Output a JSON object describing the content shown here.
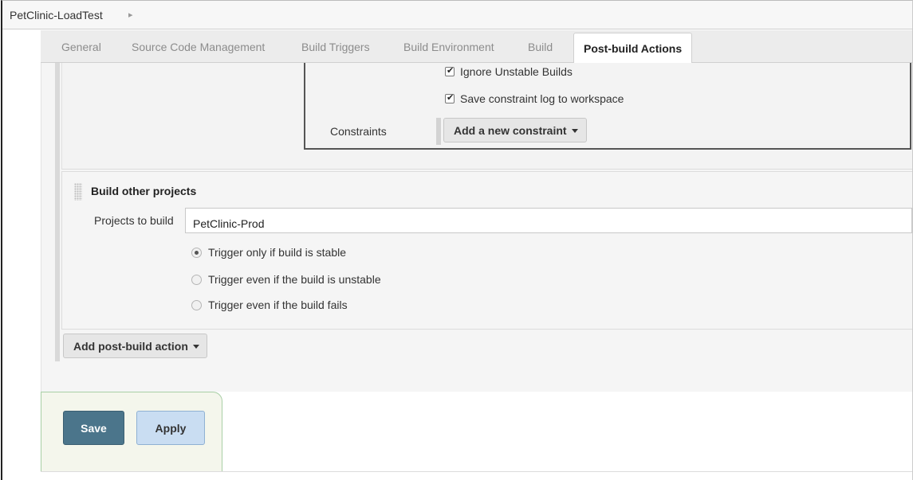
{
  "breadcrumb": {
    "project": "PetClinic-LoadTest",
    "separator_icon": "chevron-right-icon"
  },
  "tabs": [
    {
      "label": "General",
      "active": false
    },
    {
      "label": "Source Code Management",
      "active": false
    },
    {
      "label": "Build Triggers",
      "active": false
    },
    {
      "label": "Build Environment",
      "active": false
    },
    {
      "label": "Build",
      "active": false
    },
    {
      "label": "Post-build Actions",
      "active": true
    }
  ],
  "constraints_section": {
    "ignore_unstable": {
      "label": "Ignore Unstable Builds",
      "checked": true
    },
    "save_log": {
      "label": "Save constraint log to workspace",
      "checked": true
    },
    "constraints_label": "Constraints",
    "add_constraint_label": "Add a new constraint"
  },
  "build_other_projects": {
    "title": "Build other projects",
    "projects_label": "Projects to build",
    "projects_value": "PetClinic-Prod",
    "options": [
      {
        "label": "Trigger only if build is stable",
        "selected": true
      },
      {
        "label": "Trigger even if the build is unstable",
        "selected": false
      },
      {
        "label": "Trigger even if the build fails",
        "selected": false
      }
    ]
  },
  "add_post_build_label": "Add post-build action",
  "footer": {
    "save_label": "Save",
    "apply_label": "Apply"
  },
  "colors": {
    "save_button": "#4b758b",
    "apply_button": "#c9ddf2",
    "footer_border": "#a9cfa6"
  }
}
